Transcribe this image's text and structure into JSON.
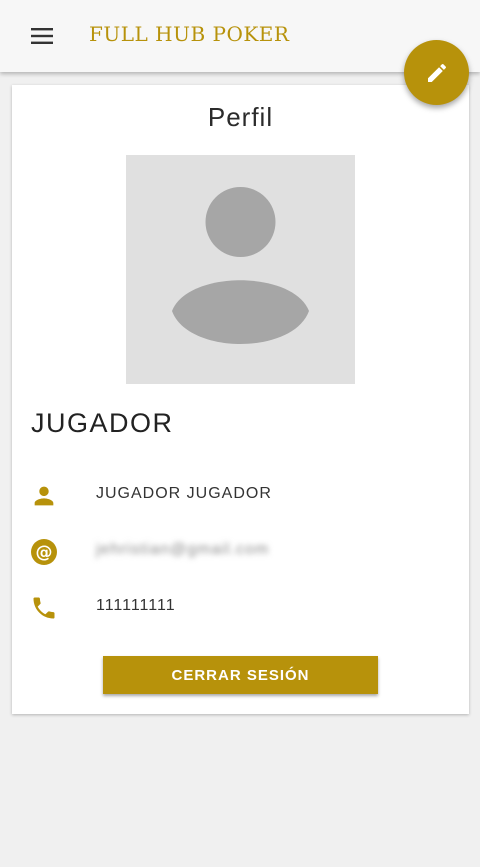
{
  "colors": {
    "accent": "#b7920b",
    "appbar": "#f7f7f7",
    "background": "#f0f0f0",
    "avatar_bg": "#e0e0e0",
    "avatar_fg": "#a6a6a6"
  },
  "appbar": {
    "menu_icon": "menu-icon",
    "title": "FULL HUB POKER",
    "fab_icon": "edit-icon"
  },
  "profile": {
    "title": "Perfil",
    "avatar_icon": "person-placeholder-icon",
    "role": "JUGADOR",
    "fields": [
      {
        "icon": "person-icon",
        "value": "JUGADOR JUGADOR"
      },
      {
        "icon": "at-icon",
        "value": "jehristian@gmail.com"
      },
      {
        "icon": "phone-icon",
        "value": "111111111"
      }
    ],
    "logout_label": "CERRAR SESIÓN"
  }
}
